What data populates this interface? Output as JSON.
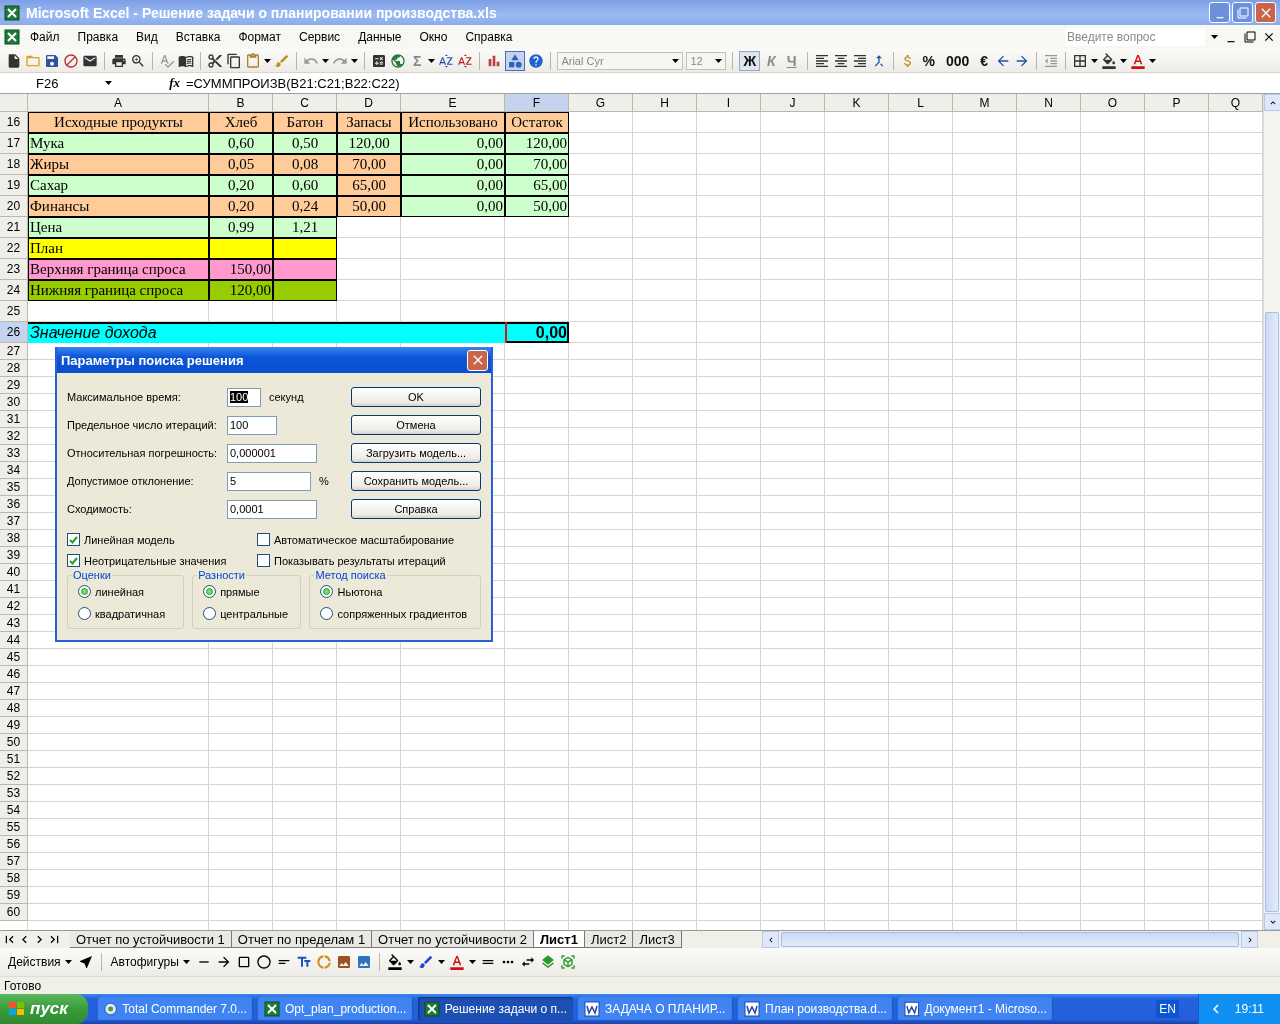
{
  "window": {
    "title": "Microsoft Excel - Решение задачи о планировании производства.xls"
  },
  "menu": [
    "Файл",
    "Правка",
    "Вид",
    "Вставка",
    "Формат",
    "Сервис",
    "Данные",
    "Окно",
    "Справка"
  ],
  "help_search": {
    "placeholder": "Введите вопрос"
  },
  "toolbar": {
    "sum": "Σ",
    "drawing_on": true,
    "font": "Arial Cyr",
    "font_size": "12",
    "styles": [
      {
        "label": "Ж",
        "selected": true
      },
      {
        "label": "К",
        "selected": false
      },
      {
        "label": "Ч",
        "selected": false
      }
    ],
    "percent": "%",
    "thousands": "000",
    "euro": "€"
  },
  "formula_bar": {
    "cell_ref": "F26",
    "fx": "fx",
    "formula": "=СУММПРОИЗВ(B21:C21;B22:C22)"
  },
  "columns": [
    {
      "label": "A",
      "selected": false
    },
    {
      "label": "B",
      "selected": false
    },
    {
      "label": "C",
      "selected": false
    },
    {
      "label": "D",
      "selected": false
    },
    {
      "label": "E",
      "selected": false
    },
    {
      "label": "F",
      "selected": true
    },
    {
      "label": "G",
      "selected": false
    },
    {
      "label": "H",
      "selected": false
    },
    {
      "label": "I",
      "selected": false
    },
    {
      "label": "J",
      "selected": false
    },
    {
      "label": "K",
      "selected": false
    },
    {
      "label": "L",
      "selected": false
    },
    {
      "label": "M",
      "selected": false
    },
    {
      "label": "N",
      "selected": false
    },
    {
      "label": "O",
      "selected": false
    },
    {
      "label": "P",
      "selected": false
    },
    {
      "label": "Q",
      "selected": false
    }
  ],
  "rows": [
    {
      "number": "16",
      "kind": "header",
      "selected": false,
      "cells": [
        {
          "text": "Исходные продукты",
          "color": "#ffcc99"
        },
        {
          "text": "Хлеб",
          "color": "#ffcc99"
        },
        {
          "text": "Батон",
          "color": "#ffcc99"
        },
        {
          "text": "Запасы",
          "color": "#ffcc99"
        },
        {
          "text": "Использовано",
          "color": "#ffcc99"
        },
        {
          "text": "Остаток",
          "color": "#ffcc99"
        }
      ]
    },
    {
      "number": "17",
      "kind": "data",
      "selected": false,
      "cells": [
        {
          "text": "Мука",
          "color": "#ccffcc",
          "kind": "label"
        },
        {
          "text": "0,60",
          "color": "#ccffcc",
          "kind": "centered"
        },
        {
          "text": "0,50",
          "color": "#ccffcc",
          "kind": "centered"
        },
        {
          "text": "120,00",
          "color": "#ccffcc",
          "kind": "centered"
        },
        {
          "text": "0,00",
          "color": "#ccffcc",
          "kind": "number"
        },
        {
          "text": "120,00",
          "color": "#ccffcc",
          "kind": "number"
        }
      ]
    },
    {
      "number": "18",
      "kind": "data",
      "selected": false,
      "cells": [
        {
          "text": "Жиры",
          "color": "#ffcc99",
          "kind": "label"
        },
        {
          "text": "0,05",
          "color": "#ffcc99",
          "kind": "centered"
        },
        {
          "text": "0,08",
          "color": "#ffcc99",
          "kind": "centered"
        },
        {
          "text": "70,00",
          "color": "#ffcc99",
          "kind": "centered"
        },
        {
          "text": "0,00",
          "color": "#ccffcc",
          "kind": "number"
        },
        {
          "text": "70,00",
          "color": "#ccffcc",
          "kind": "number"
        }
      ]
    },
    {
      "number": "19",
      "kind": "data",
      "selected": false,
      "cells": [
        {
          "text": "Сахар",
          "color": "#ccffcc",
          "kind": "label"
        },
        {
          "text": "0,20",
          "color": "#ccffcc",
          "kind": "centered"
        },
        {
          "text": "0,60",
          "color": "#ccffcc",
          "kind": "centered"
        },
        {
          "text": "65,00",
          "color": "#ffcc99",
          "kind": "centered"
        },
        {
          "text": "0,00",
          "color": "#ccffcc",
          "kind": "number"
        },
        {
          "text": "65,00",
          "color": "#ccffcc",
          "kind": "number"
        }
      ]
    },
    {
      "number": "20",
      "kind": "data",
      "selected": false,
      "cells": [
        {
          "text": "Финансы",
          "color": "#ffcc99",
          "kind": "label"
        },
        {
          "text": "0,20",
          "color": "#ffcc99",
          "kind": "centered"
        },
        {
          "text": "0,24",
          "color": "#ffcc99",
          "kind": "centered"
        },
        {
          "text": "50,00",
          "color": "#ffcc99",
          "kind": "centered"
        },
        {
          "text": "0,00",
          "color": "#ccffcc",
          "kind": "number"
        },
        {
          "text": "50,00",
          "color": "#ccffcc",
          "kind": "number"
        }
      ]
    },
    {
      "number": "21",
      "kind": "data",
      "selected": false,
      "cells": [
        {
          "text": "Цена",
          "color": "#ccffcc",
          "kind": "label"
        },
        {
          "text": "0,99",
          "color": "#ccffcc",
          "kind": "centered"
        },
        {
          "text": "1,21",
          "color": "#ccffcc",
          "kind": "centered"
        }
      ]
    },
    {
      "number": "22",
      "kind": "data",
      "selected": false,
      "cells": [
        {
          "text": "План",
          "color": "#ffff00",
          "kind": "label"
        },
        {
          "color": "#ffff00"
        },
        {
          "color": "#ffff00"
        }
      ]
    },
    {
      "number": "23",
      "kind": "data",
      "selected": false,
      "cells": [
        {
          "text": "Верхняя граница спроса",
          "color": "#ff99cc",
          "kind": "label"
        },
        {
          "text": "150,00",
          "color": "#ff99cc",
          "kind": "number"
        },
        {
          "color": "#ff99cc"
        }
      ]
    },
    {
      "number": "24",
      "kind": "data",
      "selected": false,
      "cells": [
        {
          "text": "Нижняя граница спроса",
          "color": "#99cc00",
          "kind": "label"
        },
        {
          "text": "120,00",
          "color": "#99cc00",
          "kind": "number"
        },
        {
          "color": "#99cc00"
        }
      ]
    },
    {
      "number": "25",
      "kind": "data",
      "selected": false
    },
    {
      "number": "26",
      "kind": "total",
      "selected": true,
      "cells": [
        {
          "text": "Значение дохода",
          "color": "#00ffff",
          "kind": "label"
        },
        {
          "text": "0,00",
          "color": "#00ffff",
          "kind": "number",
          "selected": true
        }
      ]
    },
    {
      "number": "27"
    },
    {
      "number": "28"
    },
    {
      "number": "29"
    },
    {
      "number": "30"
    },
    {
      "number": "31"
    },
    {
      "number": "32"
    },
    {
      "number": "33"
    },
    {
      "number": "34"
    },
    {
      "number": "35"
    },
    {
      "number": "36"
    },
    {
      "number": "37"
    },
    {
      "number": "38"
    },
    {
      "number": "39"
    },
    {
      "number": "40"
    },
    {
      "number": "41"
    },
    {
      "number": "42"
    },
    {
      "number": "43"
    },
    {
      "number": "44"
    },
    {
      "number": "45"
    },
    {
      "number": "46"
    },
    {
      "number": "47"
    },
    {
      "number": "48"
    },
    {
      "number": "49"
    },
    {
      "number": "50"
    },
    {
      "number": "51"
    },
    {
      "number": "52"
    },
    {
      "number": "53"
    },
    {
      "number": "54"
    },
    {
      "number": "55"
    },
    {
      "number": "56"
    },
    {
      "number": "57"
    },
    {
      "number": "58"
    },
    {
      "number": "59"
    },
    {
      "number": "60"
    }
  ],
  "dialog": {
    "title": "Параметры поиска решения",
    "fields": [
      {
        "label": "Максимальное время:",
        "value": "100",
        "selected": true,
        "suffix": "секунд"
      },
      {
        "label": "Предельное число итераций:",
        "value": "100",
        "selected": false
      },
      {
        "label": "Относительная погрешность:",
        "value": "0,000001",
        "selected": false
      },
      {
        "label": "Допустимое отклонение:",
        "value": "5",
        "selected": false,
        "suffix": "%"
      },
      {
        "label": "Сходимость:",
        "value": "0,0001",
        "selected": false
      }
    ],
    "buttons": [
      "OK",
      "Отмена",
      "Загрузить модель...",
      "Сохранить модель...",
      "Справка"
    ],
    "checkboxes": [
      {
        "label": "Линейная модель",
        "checked": true
      },
      {
        "label": "Автоматическое масштабирование",
        "checked": false
      },
      {
        "label": "Неотрицательные значения",
        "checked": true
      },
      {
        "label": "Показывать результаты итераций",
        "checked": false
      }
    ],
    "groups": [
      {
        "title": "Оценки",
        "options": [
          {
            "label": "линейная",
            "selected": true
          },
          {
            "label": "квадратичная",
            "selected": false
          }
        ]
      },
      {
        "title": "Разности",
        "options": [
          {
            "label": "прямые",
            "selected": true
          },
          {
            "label": "центральные",
            "selected": false
          }
        ]
      },
      {
        "title": "Метод поиска",
        "options": [
          {
            "label": "Ньютона",
            "selected": true
          },
          {
            "label": "сопряженных градиентов",
            "selected": false
          }
        ]
      }
    ]
  },
  "sheet_tabs": [
    {
      "label": "Отчет по устойчивости 1",
      "selected": false
    },
    {
      "label": "Отчет по пределам 1",
      "selected": false
    },
    {
      "label": "Отчет по устойчивости 2",
      "selected": false
    },
    {
      "label": "Лист1",
      "selected": true
    },
    {
      "label": "Лист2",
      "selected": false
    },
    {
      "label": "Лист3",
      "selected": false
    }
  ],
  "drawing_toolbar": {
    "actions": "Действия",
    "autoshapes": "Автофигуры"
  },
  "status_bar": {
    "text": "Готово"
  },
  "taskbar": {
    "start": "пуск",
    "tasks": [
      {
        "label": "Total Commander 7.0...",
        "kind": "commander",
        "selected": false
      },
      {
        "label": "Opt_plan_production...",
        "kind": "excel",
        "selected": false
      },
      {
        "label": "Решение задачи о п...",
        "kind": "excel",
        "selected": true
      },
      {
        "label": "ЗАДАЧА О ПЛАНИР...",
        "kind": "word",
        "selected": false
      },
      {
        "label": "План роизводства.d...",
        "kind": "word",
        "selected": false
      },
      {
        "label": "Документ1 - Microso...",
        "kind": "word",
        "selected": false
      }
    ],
    "language": "EN",
    "clock": "19:11"
  }
}
